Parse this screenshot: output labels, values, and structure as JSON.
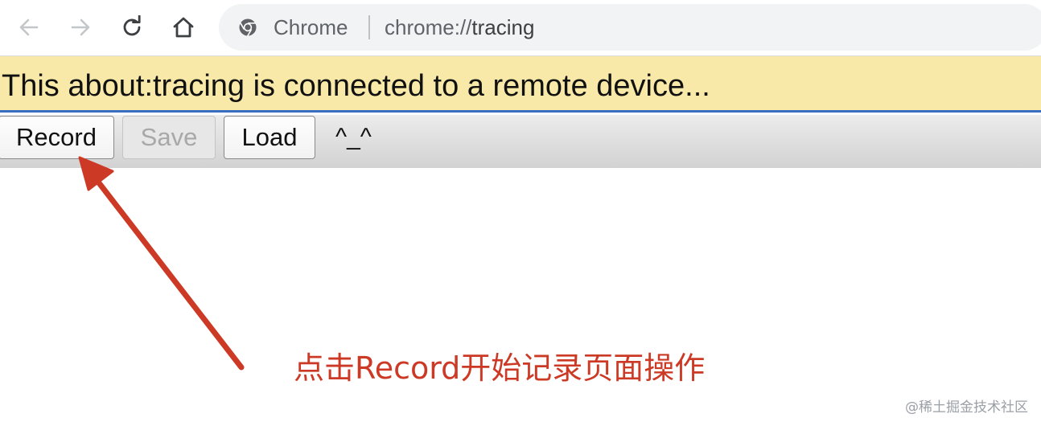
{
  "browser": {
    "site_chip": "Chrome",
    "url_scheme": "chrome://",
    "url_host": "tracing",
    "icons": [
      "back-arrow-icon",
      "forward-arrow-icon",
      "reload-icon",
      "home-icon",
      "chrome-logo-icon"
    ]
  },
  "banner": {
    "text": "This about:tracing is connected to a remote device..."
  },
  "toolbar": {
    "record_label": "Record",
    "save_label": "Save",
    "load_label": "Load",
    "extra_text": "^_^"
  },
  "annotation": {
    "caption": "点击Record开始记录页面操作",
    "color": "#cc3a26"
  },
  "watermark": "@稀土掘金技术社区"
}
